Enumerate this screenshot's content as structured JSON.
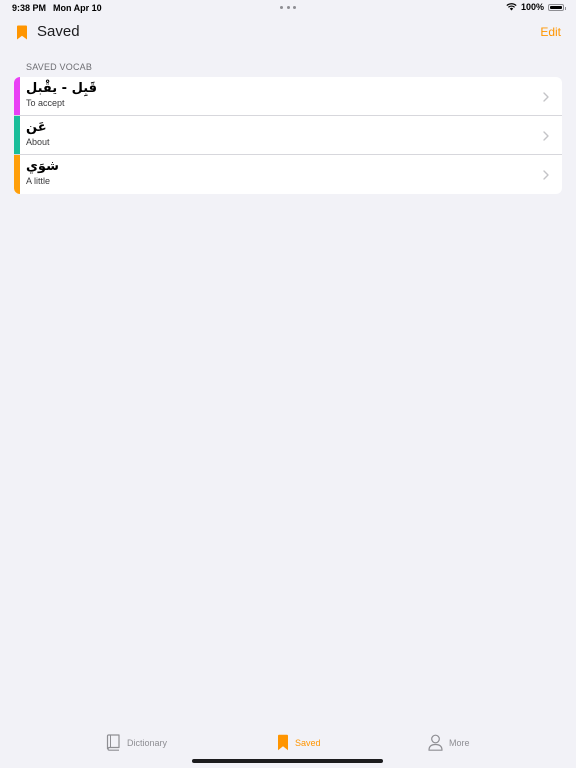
{
  "status_bar": {
    "time": "9:38 PM",
    "date": "Mon Apr 10",
    "battery_percent": "100%",
    "battery_level": 1.0,
    "wifi_icon": "wifi-icon"
  },
  "nav": {
    "title": "Saved",
    "edit_label": "Edit",
    "icon": "bookmark-icon",
    "accent_color": "#ff9500"
  },
  "section": {
    "header": "SAVED VOCAB"
  },
  "vocab": [
    {
      "arabic": "قَبِل - يقْبل",
      "english": "To accept",
      "color": "#e941f5"
    },
    {
      "arabic": "عَن",
      "english": "About",
      "color": "#1bbe9a"
    },
    {
      "arabic": "شوَي",
      "english": "A little",
      "color": "#ff9f0a"
    }
  ],
  "tabs": [
    {
      "label": "Dictionary",
      "icon": "book-icon",
      "active": false
    },
    {
      "label": "Saved",
      "icon": "bookmark-icon",
      "active": true
    },
    {
      "label": "More",
      "icon": "person-icon",
      "active": false
    }
  ]
}
